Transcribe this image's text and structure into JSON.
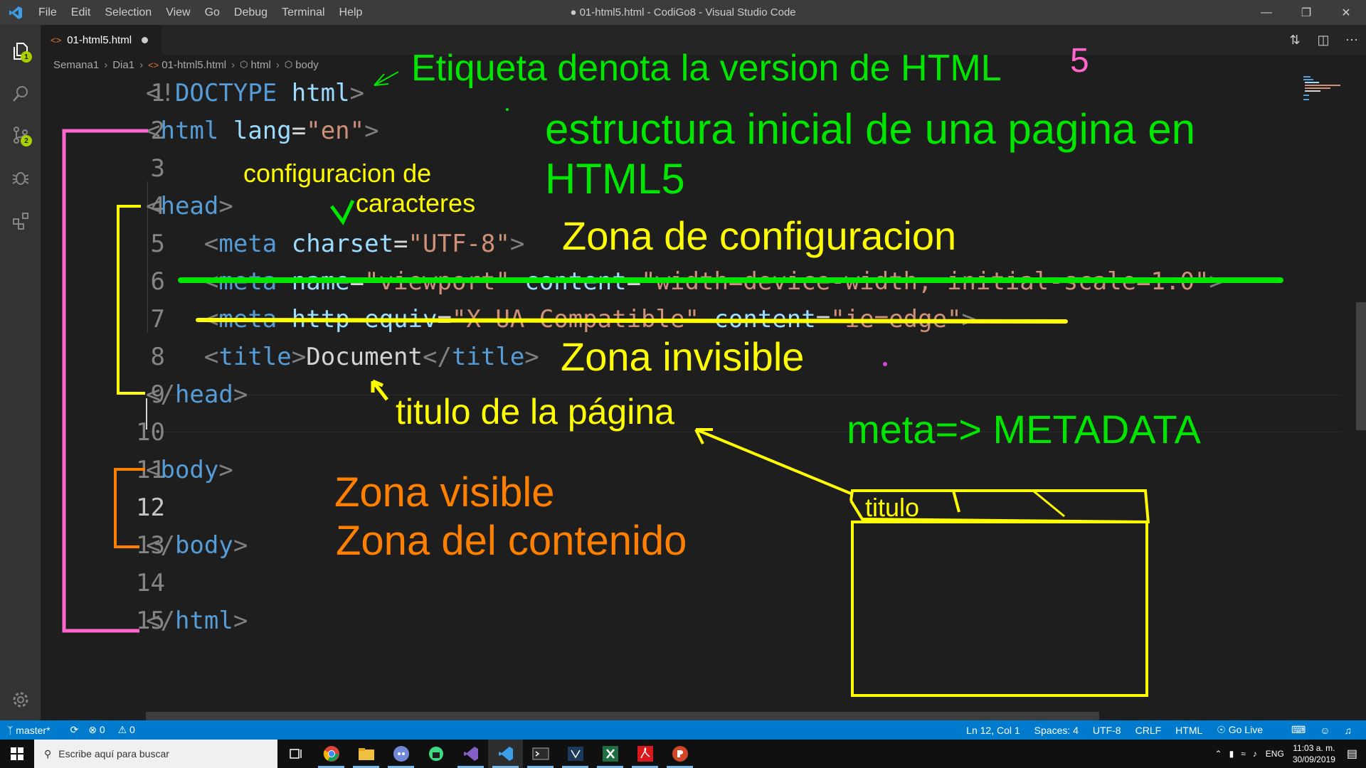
{
  "titlebar": {
    "menu": [
      "File",
      "Edit",
      "Selection",
      "View",
      "Go",
      "Debug",
      "Terminal",
      "Help"
    ],
    "window_title": "● 01-html5.html - CodiGo8 - Visual Studio Code",
    "controls": [
      "minimize-icon",
      "restore-icon",
      "close-icon"
    ]
  },
  "activitybar": {
    "items": [
      {
        "icon": "explorer-icon",
        "badge": "1"
      },
      {
        "icon": "search-icon",
        "badge": ""
      },
      {
        "icon": "source-control-icon",
        "badge": "2"
      },
      {
        "icon": "debug-icon",
        "badge": ""
      },
      {
        "icon": "extensions-icon",
        "badge": ""
      }
    ],
    "bottom_icon": "gear-icon"
  },
  "tab": {
    "label": "01-html5.html",
    "icon": "html-file-icon",
    "dirty": true
  },
  "editor_actions": [
    "compare-icon",
    "split-editor-icon",
    "more-icon"
  ],
  "breadcrumb": {
    "items": [
      "Semana1",
      "Dia1",
      "01-html5.html",
      "html",
      "body"
    ]
  },
  "code": {
    "line_numbers": [
      "1",
      "2",
      "3",
      "4",
      "5",
      "6",
      "7",
      "8",
      "9",
      "10",
      "11",
      "12",
      "13",
      "14",
      "15"
    ],
    "current_line": 12,
    "lines": [
      [
        {
          "c": "br",
          "t": "<!"
        },
        {
          "c": "tag",
          "t": "DOCTYPE"
        },
        {
          "c": "txt",
          "t": " "
        },
        {
          "c": "attr",
          "t": "html"
        },
        {
          "c": "br",
          "t": ">"
        }
      ],
      [
        {
          "c": "br",
          "t": "<"
        },
        {
          "c": "tag",
          "t": "html"
        },
        {
          "c": "txt",
          "t": " "
        },
        {
          "c": "attr",
          "t": "lang"
        },
        {
          "c": "txt",
          "t": "="
        },
        {
          "c": "str",
          "t": "\"en\""
        },
        {
          "c": "br",
          "t": ">"
        }
      ],
      [],
      [
        {
          "c": "br",
          "t": "<"
        },
        {
          "c": "tag",
          "t": "head"
        },
        {
          "c": "br",
          "t": ">"
        }
      ],
      [
        {
          "c": "txt",
          "t": "    "
        },
        {
          "c": "br",
          "t": "<"
        },
        {
          "c": "tag",
          "t": "meta"
        },
        {
          "c": "txt",
          "t": " "
        },
        {
          "c": "attr",
          "t": "charset"
        },
        {
          "c": "txt",
          "t": "="
        },
        {
          "c": "str",
          "t": "\"UTF-8\""
        },
        {
          "c": "br",
          "t": ">"
        }
      ],
      [
        {
          "c": "txt",
          "t": "    "
        },
        {
          "c": "br",
          "t": "<"
        },
        {
          "c": "tag",
          "t": "meta"
        },
        {
          "c": "txt",
          "t": " "
        },
        {
          "c": "attr",
          "t": "name"
        },
        {
          "c": "txt",
          "t": "="
        },
        {
          "c": "str",
          "t": "\"viewport\""
        },
        {
          "c": "txt",
          "t": " "
        },
        {
          "c": "attr",
          "t": "content"
        },
        {
          "c": "txt",
          "t": "="
        },
        {
          "c": "str",
          "t": "\"width=device-width, initial-scale=1.0\""
        },
        {
          "c": "br",
          "t": ">"
        }
      ],
      [
        {
          "c": "txt",
          "t": "    "
        },
        {
          "c": "br",
          "t": "<"
        },
        {
          "c": "tag",
          "t": "meta"
        },
        {
          "c": "txt",
          "t": " "
        },
        {
          "c": "attr",
          "t": "http-equiv"
        },
        {
          "c": "txt",
          "t": "="
        },
        {
          "c": "str",
          "t": "\"X-UA-Compatible\""
        },
        {
          "c": "txt",
          "t": " "
        },
        {
          "c": "attr",
          "t": "content"
        },
        {
          "c": "txt",
          "t": "="
        },
        {
          "c": "str",
          "t": "\"ie=edge\""
        },
        {
          "c": "br",
          "t": ">"
        }
      ],
      [
        {
          "c": "txt",
          "t": "    "
        },
        {
          "c": "br",
          "t": "<"
        },
        {
          "c": "tag",
          "t": "title"
        },
        {
          "c": "br",
          "t": ">"
        },
        {
          "c": "txt",
          "t": "Document"
        },
        {
          "c": "br",
          "t": "</"
        },
        {
          "c": "tag",
          "t": "title"
        },
        {
          "c": "br",
          "t": ">"
        }
      ],
      [
        {
          "c": "br",
          "t": "</"
        },
        {
          "c": "tag",
          "t": "head"
        },
        {
          "c": "br",
          "t": ">"
        }
      ],
      [],
      [
        {
          "c": "br",
          "t": "<"
        },
        {
          "c": "tag",
          "t": "body"
        },
        {
          "c": "br",
          "t": ">"
        }
      ],
      [],
      [
        {
          "c": "br",
          "t": "</"
        },
        {
          "c": "tag",
          "t": "body"
        },
        {
          "c": "br",
          "t": ">"
        }
      ],
      [],
      [
        {
          "c": "br",
          "t": "</"
        },
        {
          "c": "tag",
          "t": "html"
        },
        {
          "c": "br",
          "t": ">"
        }
      ]
    ]
  },
  "annotations": {
    "etiqueta": "Etiqueta denota la version de HTML",
    "five": "5",
    "estructura_1": "estructura inicial de una pagina en",
    "estructura_2": "HTML5",
    "config_chars_1": "configuracion de",
    "config_chars_2": "caracteres",
    "zona_config": "Zona de configuracion",
    "zona_invisible": "Zona invisible",
    "titulo_pagina": "titulo de la página",
    "meta_metadata": "meta=> METADATA",
    "zona_visible": "Zona visible",
    "zona_contenido": "Zona del contenido",
    "sketch_tab": "titulo",
    "colors": {
      "green": "#00e600",
      "yellow": "#ffff00",
      "pink": "#ff66cc",
      "orange": "#ff7f00",
      "magenta": "#e040e0"
    }
  },
  "statusbar": {
    "branch": "master*",
    "sync_icon": "sync-icon",
    "errors": "0",
    "warnings": "0",
    "position": "Ln 12, Col 1",
    "spaces": "Spaces: 4",
    "encoding": "UTF-8",
    "eol": "CRLF",
    "language": "HTML",
    "golive": "Go Live",
    "icons_right": [
      "terminal-icon",
      "smiley-icon",
      "bell-icon"
    ]
  },
  "taskbar": {
    "search_placeholder": "Escribe aquí para buscar",
    "apps": [
      "task-view-icon",
      "chrome-icon",
      "file-explorer-icon",
      "discord-icon",
      "android-icon",
      "visual-studio-icon",
      "vscode-icon",
      "terminal-icon",
      "hyper-icon",
      "excel-icon",
      "acrobat-icon",
      "powerpoint-icon"
    ],
    "language": "ENG",
    "time": "11:03 a. m.",
    "date": "30/09/2019"
  }
}
